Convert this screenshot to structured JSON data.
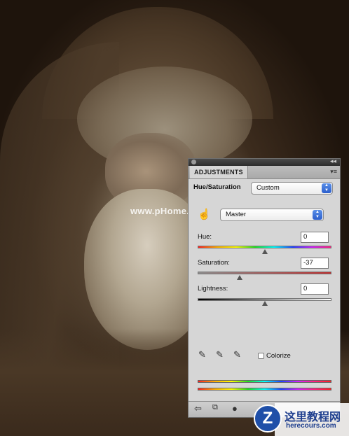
{
  "photo": {
    "watermark": "www.pHome.NET"
  },
  "panel": {
    "tab_label": "ADJUSTMENTS",
    "adjustment_name": "Hue/Saturation",
    "preset": {
      "selected": "Custom"
    },
    "channel": {
      "selected": "Master"
    },
    "hue": {
      "label": "Hue:",
      "value": "0",
      "fraction": 0.5
    },
    "saturation": {
      "label": "Saturation:",
      "value": "-37",
      "fraction": 0.315
    },
    "lightness": {
      "label": "Lightness:",
      "value": "0",
      "fraction": 0.5
    },
    "colorize": {
      "label": "Colorize",
      "checked": false
    },
    "icons": [
      "hand-tool-icon",
      "eyedropper-icon",
      "eyedropper-plus-icon",
      "eyedropper-minus-icon",
      "back-arrow-icon",
      "expand-view-icon",
      "layer-mask-icon"
    ]
  },
  "logo": {
    "site_cn": "这里教程网",
    "site_url": "herecours.com"
  },
  "colors": {
    "panel_bg": "#d6d6d6",
    "select_arrow": "#2c5fcc",
    "logo_blue": "#1f4fa8"
  }
}
